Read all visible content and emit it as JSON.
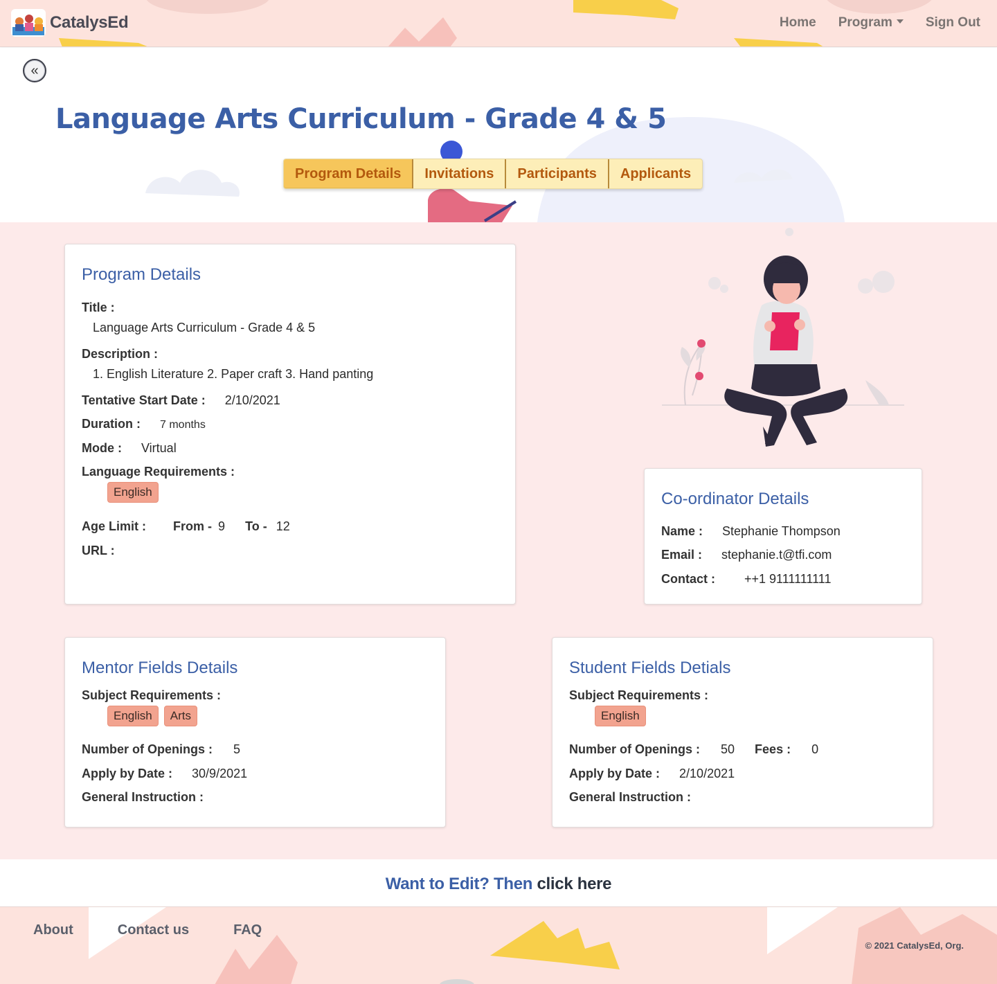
{
  "navbar": {
    "brand": "CatalysEd",
    "links": {
      "home": "Home",
      "program": "Program",
      "sign_out": "Sign Out"
    }
  },
  "hero": {
    "back_symbol": "«",
    "title": "Language Arts Curriculum - Grade 4 & 5",
    "tabs": [
      "Program Details",
      "Invitations",
      "Participants",
      "Applicants"
    ],
    "active_tab": "Program Details"
  },
  "program_details": {
    "heading": "Program Details",
    "title_label": "Title :",
    "title_value": "Language Arts Curriculum - Grade 4 & 5",
    "description_label": "Description :",
    "description_value": "1. English Literature 2. Paper craft 3. Hand panting",
    "start_label": "Tentative Start Date :",
    "start_value": "2/10/2021",
    "duration_label": "Duration :",
    "duration_value": "7 months",
    "mode_label": "Mode :",
    "mode_value": "Virtual",
    "language_label": "Language Requirements :",
    "languages": [
      "English"
    ],
    "age_label": "Age Limit :",
    "age_from_label": "From -",
    "age_from": "9",
    "age_to_label": "To -",
    "age_to": "12",
    "url_label": "URL :"
  },
  "coordinator": {
    "heading": "Co-ordinator Details",
    "name_label": "Name :",
    "name_value": "Stephanie Thompson",
    "email_label": "Email :",
    "email_value": "stephanie.t@tfi.com",
    "contact_label": "Contact :",
    "contact_value": "++1 9111111111"
  },
  "mentor": {
    "heading": "Mentor Fields Details",
    "subject_label": "Subject Requirements :",
    "subjects": [
      "English",
      "Arts"
    ],
    "openings_label": "Number of Openings :",
    "openings_value": "5",
    "apply_label": "Apply by Date :",
    "apply_value": "30/9/2021",
    "instruction_label": "General Instruction :"
  },
  "student": {
    "heading": "Student Fields Detials",
    "subject_label": "Subject Requirements :",
    "subjects": [
      "English"
    ],
    "openings_label": "Number of Openings :",
    "openings_value": "50",
    "fees_label": "Fees :",
    "fees_value": "0",
    "apply_label": "Apply by Date :",
    "apply_value": "2/10/2021",
    "instruction_label": "General Instruction :"
  },
  "edit": {
    "prompt": "Want to Edit? Then",
    "link": "click here"
  },
  "footer": {
    "links": [
      "About",
      "Contact us",
      "FAQ"
    ],
    "copyright": "© 2021 CatalysEd, Org."
  },
  "colors": {
    "accent_blue": "#3b5fa6",
    "tab_active": "#f6c65b",
    "tab_text": "#b3590e",
    "badge": "#f2a38f",
    "page_pink": "#fdeaea",
    "nav_pink": "#fde3dd"
  }
}
